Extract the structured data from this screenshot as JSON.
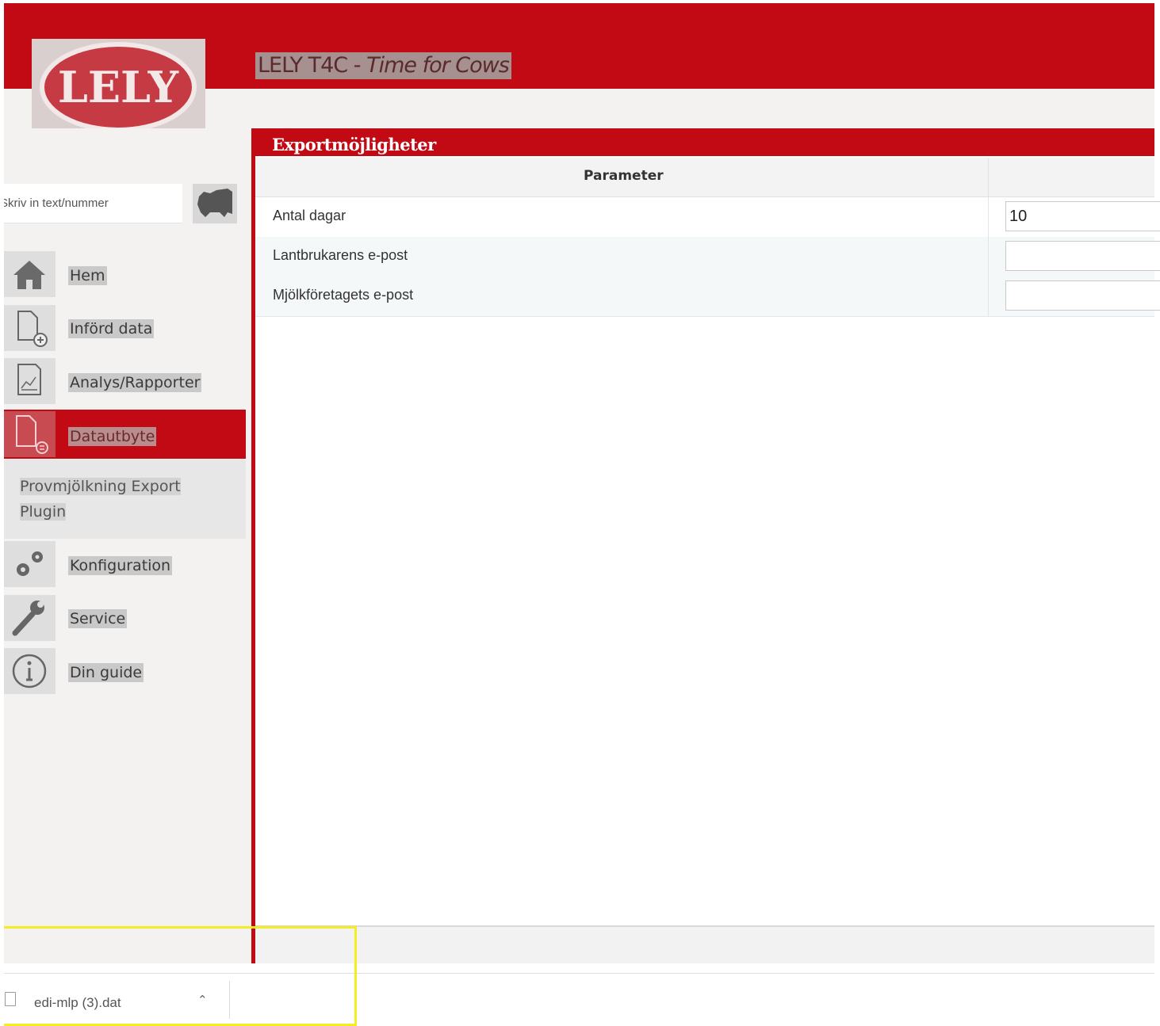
{
  "header": {
    "logo_text": "LELY",
    "title_main": "LELY T4C - ",
    "title_sub": "Time for Cows"
  },
  "search": {
    "placeholder": "Skriv in text/nummer"
  },
  "nav": {
    "items": [
      {
        "label": "Hem",
        "icon": "house-icon"
      },
      {
        "label": "Införd data",
        "icon": "document-add-icon"
      },
      {
        "label": "Analys/Rapporter",
        "icon": "report-chart-icon"
      },
      {
        "label": "Datautbyte",
        "icon": "document-exchange-icon"
      },
      {
        "label": "Konfiguration",
        "icon": "gears-icon"
      },
      {
        "label": "Service",
        "icon": "wrench-icon"
      },
      {
        "label": "Din guide",
        "icon": "info-icon"
      }
    ],
    "sub_item": "Provmjölkning Export Plugin"
  },
  "panel": {
    "title": "Exportmöjligheter",
    "column_header": "Parameter",
    "rows": [
      {
        "label": "Antal dagar",
        "value": "10"
      },
      {
        "label": "Lantbrukarens e-post",
        "value": ""
      },
      {
        "label": "Mjölkföretagets e-post",
        "value": ""
      }
    ]
  },
  "downloads": {
    "file_name": "edi-mlp (3).dat"
  },
  "colors": {
    "brand_red": "#c20a15",
    "highlight_yellow": "#f5ec23"
  }
}
